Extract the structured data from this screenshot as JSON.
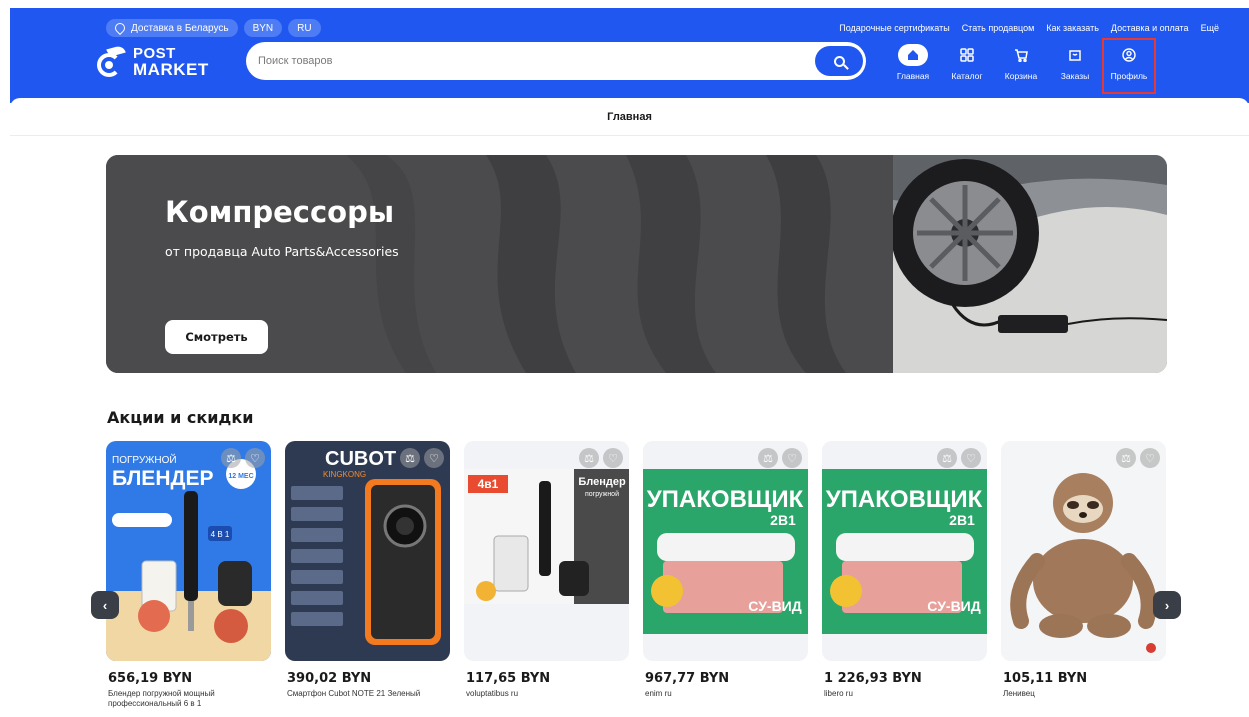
{
  "header": {
    "delivery_pill": "Доставка в Беларусь",
    "currency_pill": "BYN",
    "language_pill": "RU",
    "top_links": [
      "Подарочные сертификаты",
      "Стать продавцом",
      "Как заказать",
      "Доставка и оплата",
      "Ещё"
    ],
    "logo_line1": "POST",
    "logo_line2": "MARKET",
    "search_placeholder": "Поиск товаров",
    "nav": [
      {
        "label": "Главная",
        "icon": "home-icon"
      },
      {
        "label": "Каталог",
        "icon": "catalog-icon"
      },
      {
        "label": "Корзина",
        "icon": "cart-icon"
      },
      {
        "label": "Заказы",
        "icon": "orders-icon"
      },
      {
        "label": "Профиль",
        "icon": "profile-icon"
      }
    ]
  },
  "breadcrumb": "Главная",
  "banner": {
    "title": "Компрессоры",
    "subtitle": "от продавца Auto Parts&Accessories",
    "button": "Смотреть"
  },
  "section": {
    "title": "Акции и скидки"
  },
  "products": [
    {
      "price": "656,19 BYN",
      "title": "Блендер погружной мощный профессиональный 6 в 1"
    },
    {
      "price": "390,02 BYN",
      "title": "Смартфон Cubot NOTE 21 Зеленый"
    },
    {
      "price": "117,65 BYN",
      "title": "voluptatibus ru"
    },
    {
      "price": "967,77 BYN",
      "title": "enim ru"
    },
    {
      "price": "1 226,93 BYN",
      "title": "libero ru"
    },
    {
      "price": "105,11 BYN",
      "title": "Ленивец"
    }
  ],
  "image_text": {
    "blender_top": "ПОГРУЖНОЙ",
    "blender_big": "БЛЕНДЕР",
    "blender_badge": "12 МЕС",
    "blender_4in1": "4 В 1",
    "cubot_brand": "CUBOT",
    "cubot_model": "KINGKONG",
    "blender2_badge": "4в1",
    "blender2_title": "Блендер",
    "blender2_sub": "погружной",
    "pack_title": "УПАКОВЩИК",
    "pack_sub": "2В1",
    "pack_foot": "СУ-ВИД"
  },
  "colors": {
    "brand_blue": "#1f57f0",
    "profile_highlight": "#e53935",
    "banner_dark": "#4a4a4c"
  }
}
